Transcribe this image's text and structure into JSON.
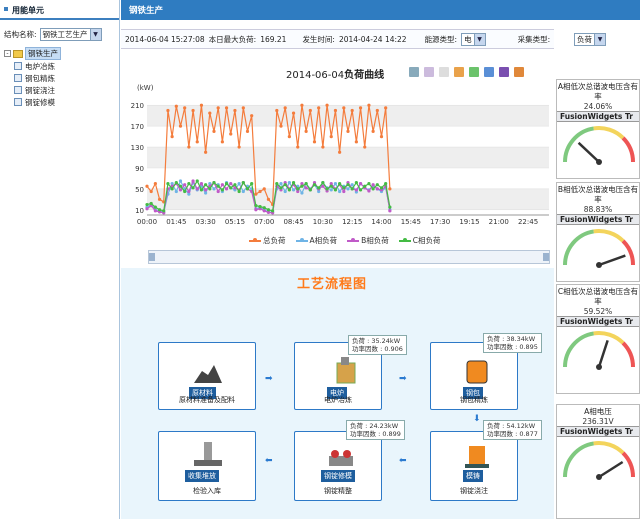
{
  "left": {
    "header": "用能单元",
    "struct_label": "结构名称:",
    "struct_value": "钢铁工艺生产",
    "tree_root": "钢铁生产",
    "tree_items": [
      "电炉冶炼",
      "钢包精炼",
      "钢锭浇注",
      "钢锭修模"
    ]
  },
  "topbar": {
    "title": "钢铁生产"
  },
  "info": {
    "timestamp": "2014-06-04 15:27:08",
    "max_load_label": "本日最大负荷:",
    "max_load_value": "169.21",
    "occur_label": "发生时间:",
    "occur_value": "2014-04-24 14:22",
    "energy_label": "能源类型:",
    "energy_value": "电",
    "collect_label": "采集类型:",
    "collect_value": "负荷"
  },
  "chart_data": {
    "type": "line",
    "title_date": "2014-06-04",
    "title_text": "负荷曲线",
    "ylabel": "(kW)",
    "yticks": [
      10,
      50,
      90,
      130,
      170,
      210
    ],
    "ylim": [
      0,
      220
    ],
    "xticks": [
      "00:00",
      "01:45",
      "03:30",
      "05:15",
      "07:00",
      "08:45",
      "10:30",
      "12:15",
      "14:00",
      "15:45",
      "17:30",
      "19:15",
      "21:00",
      "22:45"
    ],
    "xlim": [
      0,
      1440
    ],
    "series": [
      {
        "name": "总负荷",
        "color": "#f47c3c",
        "x": [
          0,
          15,
          30,
          45,
          60,
          75,
          90,
          105,
          120,
          135,
          150,
          165,
          180,
          195,
          210,
          225,
          240,
          255,
          270,
          285,
          300,
          315,
          330,
          345,
          360,
          375,
          390,
          405,
          420,
          435,
          450,
          465,
          480,
          495,
          510,
          525,
          540,
          555,
          570,
          585,
          600,
          615,
          630,
          645,
          660,
          675,
          690,
          705,
          720,
          735,
          750,
          765,
          780,
          795,
          810,
          825,
          840,
          855,
          870
        ],
        "y": [
          55,
          45,
          60,
          30,
          25,
          200,
          150,
          208,
          170,
          205,
          130,
          200,
          140,
          210,
          120,
          195,
          160,
          205,
          140,
          205,
          155,
          200,
          130,
          205,
          160,
          190,
          40,
          45,
          50,
          30,
          20,
          200,
          170,
          205,
          150,
          195,
          130,
          210,
          160,
          200,
          140,
          205,
          130,
          210,
          150,
          200,
          120,
          205,
          160,
          200,
          140,
          205,
          130,
          210,
          160,
          200,
          150,
          205,
          50
        ]
      },
      {
        "name": "A相负荷",
        "color": "#6fb4e6",
        "x": [
          0,
          15,
          30,
          45,
          60,
          75,
          90,
          105,
          120,
          135,
          150,
          165,
          180,
          195,
          210,
          225,
          240,
          255,
          270,
          285,
          300,
          315,
          330,
          345,
          360,
          375,
          390,
          405,
          420,
          435,
          450,
          465,
          480,
          495,
          510,
          525,
          540,
          555,
          570,
          585,
          600,
          615,
          630,
          645,
          660,
          675,
          690,
          705,
          720,
          735,
          750,
          765,
          780,
          795,
          810,
          825,
          840,
          855,
          870
        ],
        "y": [
          15,
          20,
          10,
          8,
          5,
          40,
          60,
          45,
          65,
          50,
          40,
          62,
          48,
          55,
          42,
          60,
          50,
          58,
          45,
          62,
          52,
          48,
          60,
          45,
          55,
          50,
          12,
          14,
          10,
          6,
          5,
          50,
          60,
          45,
          62,
          48,
          55,
          42,
          60,
          50,
          58,
          45,
          62,
          52,
          48,
          60,
          45,
          55,
          50,
          58,
          44,
          60,
          52,
          48,
          56,
          50,
          45,
          52,
          10
        ]
      },
      {
        "name": "B相负荷",
        "color": "#c05ac8",
        "x": [
          0,
          15,
          30,
          45,
          60,
          75,
          90,
          105,
          120,
          135,
          150,
          165,
          180,
          195,
          210,
          225,
          240,
          255,
          270,
          285,
          300,
          315,
          330,
          345,
          360,
          375,
          390,
          405,
          420,
          435,
          450,
          465,
          480,
          495,
          510,
          525,
          540,
          555,
          570,
          585,
          600,
          615,
          630,
          645,
          660,
          675,
          690,
          705,
          720,
          735,
          750,
          765,
          780,
          795,
          810,
          825,
          840,
          855,
          870
        ],
        "y": [
          12,
          18,
          8,
          6,
          4,
          50,
          55,
          60,
          48,
          58,
          45,
          65,
          50,
          60,
          48,
          55,
          62,
          45,
          58,
          50,
          60,
          52,
          48,
          62,
          50,
          45,
          10,
          12,
          8,
          5,
          4,
          55,
          48,
          62,
          50,
          58,
          45,
          60,
          52,
          48,
          62,
          50,
          55,
          46,
          60,
          50,
          58,
          45,
          62,
          50,
          48,
          60,
          52,
          46,
          58,
          50,
          48,
          55,
          8
        ]
      },
      {
        "name": "C相负荷",
        "color": "#44bb44",
        "x": [
          0,
          15,
          30,
          45,
          60,
          75,
          90,
          105,
          120,
          135,
          150,
          165,
          180,
          195,
          210,
          225,
          240,
          255,
          270,
          285,
          300,
          315,
          330,
          345,
          360,
          375,
          390,
          405,
          420,
          435,
          450,
          465,
          480,
          495,
          510,
          525,
          540,
          555,
          570,
          585,
          600,
          615,
          630,
          645,
          660,
          675,
          690,
          705,
          720,
          735,
          750,
          765,
          780,
          795,
          810,
          825,
          840,
          855,
          870
        ],
        "y": [
          20,
          22,
          15,
          10,
          8,
          60,
          50,
          62,
          55,
          45,
          60,
          52,
          65,
          48,
          58,
          50,
          62,
          55,
          48,
          60,
          52,
          58,
          45,
          62,
          50,
          60,
          18,
          16,
          14,
          10,
          8,
          60,
          52,
          58,
          48,
          62,
          50,
          55,
          60,
          48,
          58,
          52,
          62,
          50,
          55,
          48,
          60,
          52,
          58,
          50,
          62,
          48,
          55,
          60,
          50,
          58,
          52,
          60,
          15
        ]
      }
    ]
  },
  "flow": {
    "title": "工艺流程图",
    "cards": [
      {
        "name": "raw",
        "label": "原材料",
        "caption": "原材料准备及配料"
      },
      {
        "name": "ef",
        "label": "电炉",
        "caption": "电炉冶炼"
      },
      {
        "name": "ladle",
        "label": "钢包",
        "caption": "钢包精炼"
      },
      {
        "name": "store",
        "label": "收集堆放",
        "caption": "检验入库"
      },
      {
        "name": "mold",
        "label": "钢锭修模",
        "caption": "钢锭精整"
      },
      {
        "name": "cast",
        "label": "模铸",
        "caption": "钢锭浇注"
      }
    ],
    "bubbles": [
      {
        "load": "负荷 : 35.24kW",
        "pf": "功率因数 : 0.906"
      },
      {
        "load": "负荷 : 38.34kW",
        "pf": "功率因数 : 0.895"
      },
      {
        "load": "负荷 : 24.23kW",
        "pf": "功率因数 : 0.899"
      },
      {
        "load": "负荷 : 54.12kW",
        "pf": "功率因数 : 0.877"
      }
    ]
  },
  "gauges": [
    {
      "title": "A相低次总谐波电压含有率",
      "value": "24.06%",
      "brand": "FusionWidgets Tr",
      "ticks": [
        "50",
        "60",
        "70",
        "80",
        "90",
        "100",
        "40",
        "30",
        "20",
        "10",
        "0"
      ],
      "level": 0.24
    },
    {
      "title": "B相低次总谐波电压含有率",
      "value": "88.83%",
      "brand": "FusionWidgets Tr",
      "ticks": [
        "50",
        "60",
        "70",
        "80",
        "90",
        "100",
        "40",
        "30",
        "20",
        "10",
        "0"
      ],
      "level": 0.89
    },
    {
      "title": "C相低次总谐波电压含有率",
      "value": "59.52%",
      "brand": "FusionWidgets Tr",
      "ticks": [
        "50",
        "60",
        "70",
        "80",
        "90",
        "100",
        "40",
        "30",
        "20",
        "10",
        "0"
      ],
      "level": 0.6
    },
    {
      "title": "A相电压",
      "value": "236.31V",
      "brand": "FusionWidgets Tr",
      "ticks": [
        "141",
        "148",
        "114",
        "171",
        "200",
        "228",
        "27",
        "0"
      ],
      "level": 0.82
    }
  ]
}
